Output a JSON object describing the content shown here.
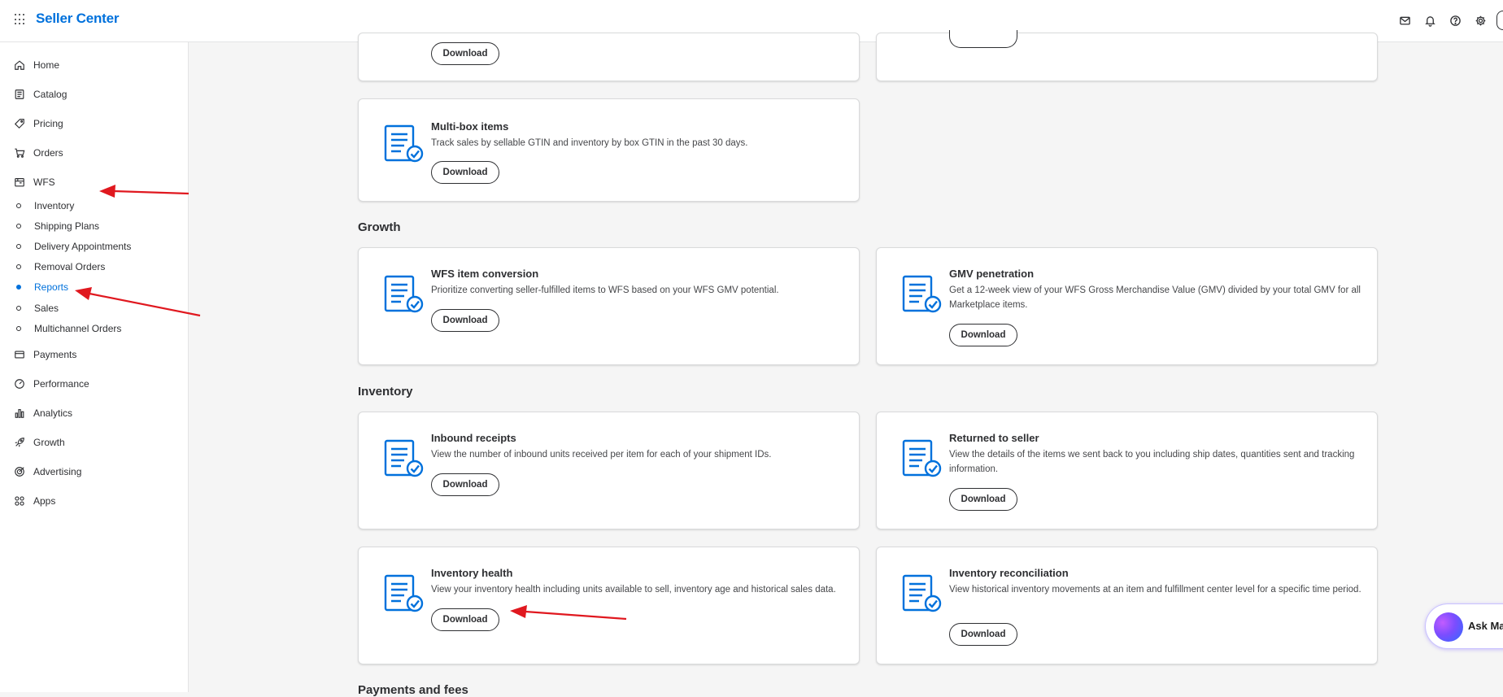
{
  "header": {
    "brand": "Seller Center",
    "icons": [
      "mail-icon",
      "bell-icon",
      "help-icon",
      "gear-icon"
    ]
  },
  "sidebar": {
    "items": [
      {
        "label": "Home",
        "icon": "home-icon"
      },
      {
        "label": "Catalog",
        "icon": "catalog-icon"
      },
      {
        "label": "Pricing",
        "icon": "tag-icon"
      },
      {
        "label": "Orders",
        "icon": "cart-icon"
      },
      {
        "label": "WFS",
        "icon": "warehouse-icon"
      },
      {
        "label": "Payments",
        "icon": "card-icon"
      },
      {
        "label": "Performance",
        "icon": "gauge-icon"
      },
      {
        "label": "Analytics",
        "icon": "bar-chart-icon"
      },
      {
        "label": "Growth",
        "icon": "rocket-icon"
      },
      {
        "label": "Advertising",
        "icon": "target-icon"
      },
      {
        "label": "Apps",
        "icon": "apps-icon"
      }
    ],
    "wfs_subitems": [
      {
        "label": "Inventory",
        "active": false
      },
      {
        "label": "Shipping Plans",
        "active": false
      },
      {
        "label": "Delivery Appointments",
        "active": false
      },
      {
        "label": "Removal Orders",
        "active": false
      },
      {
        "label": "Reports",
        "active": true
      },
      {
        "label": "Sales",
        "active": false
      },
      {
        "label": "Multichannel Orders",
        "active": false
      }
    ]
  },
  "main": {
    "download_label": "Download",
    "top_cards": [
      {
        "title": "Multi-box items",
        "description": "Track sales by sellable GTIN and inventory by box GTIN in the past 30 days."
      }
    ],
    "sections": [
      {
        "title": "Growth",
        "cards": [
          {
            "title": "WFS item conversion",
            "description": "Prioritize converting seller-fulfilled items to WFS based on your WFS GMV potential."
          },
          {
            "title": "GMV penetration",
            "description": "Get a 12-week view of your WFS Gross Merchandise Value (GMV) divided by your total GMV for all Marketplace items."
          }
        ]
      },
      {
        "title": "Inventory",
        "cards": [
          {
            "title": "Inbound receipts",
            "description": "View the number of inbound units received per item for each of your shipment IDs."
          },
          {
            "title": "Returned to seller",
            "description": "View the details of the items we sent back to you including ship dates, quantities sent and tracking information."
          },
          {
            "title": "Inventory health",
            "description": "View your inventory health including units available to sell, inventory age and historical sales data."
          },
          {
            "title": "Inventory reconciliation",
            "description": "View historical inventory movements at an item and fulfillment center level for a specific time period."
          }
        ]
      },
      {
        "title": "Payments and fees"
      }
    ]
  },
  "assistant": {
    "label": "Ask Ma"
  },
  "colors": {
    "brand": "#0071dc",
    "annotation_arrow": "#e0181f"
  }
}
